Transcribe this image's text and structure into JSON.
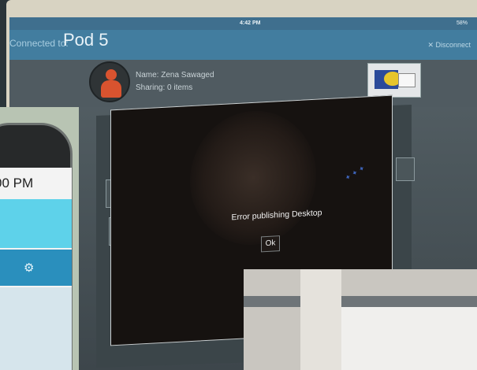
{
  "status_bar": {
    "time": "4:42 PM",
    "battery": "58%"
  },
  "header": {
    "connected_label": "Connected to:",
    "pod_name": "Pod 5",
    "disconnect": "✕ Disconnect"
  },
  "user": {
    "name": "Name: Zena Sawaged",
    "sharing": "Sharing: 0 items"
  },
  "dialog": {
    "message": "Error publishing Desktop",
    "ok_label": "Ok"
  },
  "phone": {
    "time": "00 PM",
    "settings_icon": "gear-icon"
  },
  "colors": {
    "header_blue": "#427d9f",
    "avatar_red": "#d9532f",
    "phone_cyan": "#5ed2ea"
  }
}
